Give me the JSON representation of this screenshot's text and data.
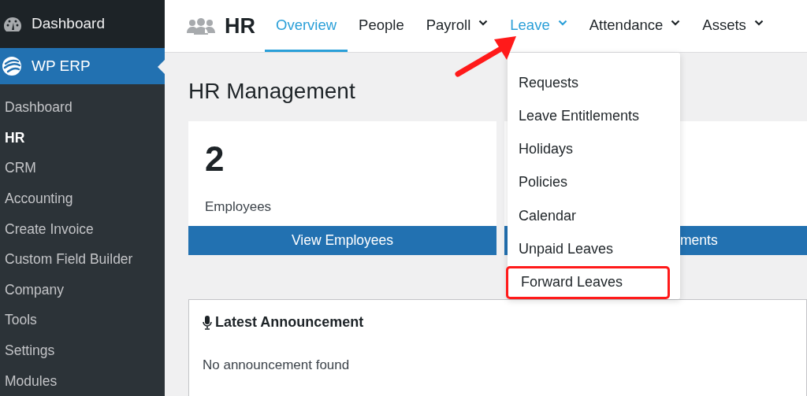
{
  "sidebar": {
    "top_item": {
      "label": "Dashboard"
    },
    "active_menu": {
      "label": "WP ERP"
    },
    "submenu": [
      {
        "label": "Dashboard",
        "selected": false
      },
      {
        "label": "HR",
        "selected": true
      },
      {
        "label": "CRM",
        "selected": false
      },
      {
        "label": "Accounting",
        "selected": false
      },
      {
        "label": "Create Invoice",
        "selected": false
      },
      {
        "label": "Custom Field Builder",
        "selected": false
      },
      {
        "label": "Company",
        "selected": false
      },
      {
        "label": "Tools",
        "selected": false
      },
      {
        "label": "Settings",
        "selected": false
      },
      {
        "label": "Modules",
        "selected": false
      }
    ]
  },
  "header": {
    "title": "HR",
    "tabs": [
      {
        "label": "Overview",
        "selected": true,
        "dropdown": false,
        "open": false
      },
      {
        "label": "People",
        "selected": false,
        "dropdown": false,
        "open": false
      },
      {
        "label": "Payroll",
        "selected": false,
        "dropdown": true,
        "open": false
      },
      {
        "label": "Leave",
        "selected": false,
        "dropdown": true,
        "open": true
      },
      {
        "label": "Attendance",
        "selected": false,
        "dropdown": true,
        "open": false
      },
      {
        "label": "Assets",
        "selected": false,
        "dropdown": true,
        "open": false
      }
    ]
  },
  "page_title": "HR Management",
  "cards": [
    {
      "count": "2",
      "label": "Employees",
      "button": "View Employees"
    },
    {
      "button": "ments"
    }
  ],
  "dropdown": {
    "items": [
      {
        "label": "Requests",
        "highlighted": false
      },
      {
        "label": "Leave Entitlements",
        "highlighted": false
      },
      {
        "label": "Holidays",
        "highlighted": false
      },
      {
        "label": "Policies",
        "highlighted": false
      },
      {
        "label": "Calendar",
        "highlighted": false
      },
      {
        "label": "Unpaid Leaves",
        "highlighted": false
      },
      {
        "label": "Forward Leaves",
        "highlighted": true
      }
    ]
  },
  "announcement": {
    "title": "Latest Announcement",
    "message": "No announcement found"
  }
}
